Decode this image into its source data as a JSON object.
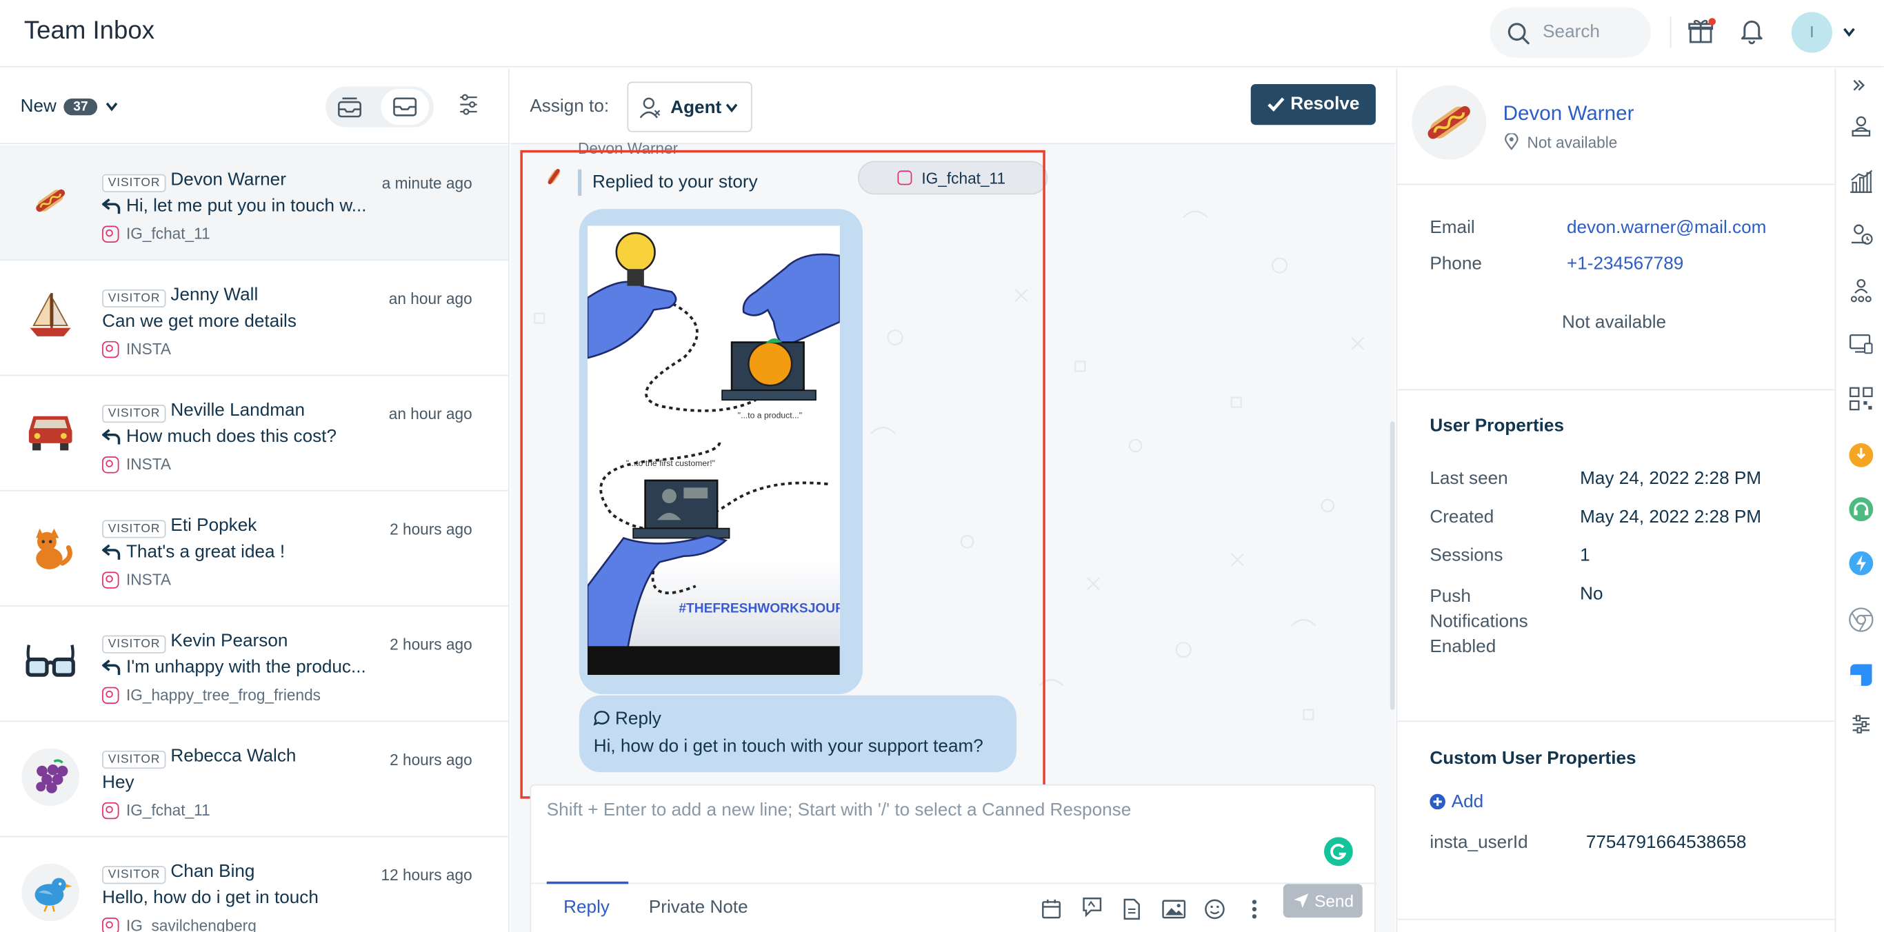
{
  "header": {
    "title": "Team Inbox",
    "search_placeholder": "Search",
    "avatar_initial": "I"
  },
  "list": {
    "filter_label": "New",
    "filter_count": "37",
    "conversations": [
      {
        "badge": "VISITOR",
        "name": "Devon Warner",
        "time": "a minute ago",
        "message": "Hi, let me put you in touch w...",
        "channel": "IG_fchat_11",
        "reply_icon": true,
        "avatar": "hotdog-avatar"
      },
      {
        "badge": "VISITOR",
        "name": "Jenny Wall",
        "time": "an hour ago",
        "message": "Can we get more details",
        "channel": "INSTA",
        "reply_icon": false,
        "avatar": "sailboat-avatar"
      },
      {
        "badge": "VISITOR",
        "name": "Neville Landman",
        "time": "an hour ago",
        "message": "How much does this cost?",
        "channel": "INSTA",
        "reply_icon": true,
        "avatar": "car-avatar"
      },
      {
        "badge": "VISITOR",
        "name": "Eti Popkek",
        "time": "2 hours ago",
        "message": "That's a great idea !",
        "channel": "INSTA",
        "reply_icon": true,
        "avatar": "cat-avatar"
      },
      {
        "badge": "VISITOR",
        "name": "Kevin Pearson",
        "time": "2 hours ago",
        "message": "I'm unhappy with the produc...",
        "channel": "IG_happy_tree_frog_friends",
        "reply_icon": true,
        "avatar": "glasses-avatar"
      },
      {
        "badge": "VISITOR",
        "name": "Rebecca Walch",
        "time": "2 hours ago",
        "message": "Hey",
        "channel": "IG_fchat_11",
        "reply_icon": false,
        "avatar": "grapes-avatar"
      },
      {
        "badge": "VISITOR",
        "name": "Chan Bing",
        "time": "12 hours ago",
        "message": "Hello, how do i get in touch",
        "channel": "IG_savilchengberg",
        "reply_icon": false,
        "avatar": "bird-avatar"
      }
    ]
  },
  "chat": {
    "assign_label": "Assign to:",
    "agent_label": "Agent",
    "resolve_label": "Resolve",
    "sender_name": "Devon Warner",
    "story_reply_text": "Replied to your story",
    "channel_chip": "IG_fchat_11",
    "story": {
      "caption_product": "\"...to a product...\"",
      "caption_customer": "\"...to the first customer!\"",
      "hashtag": "#THEFRESHWORKSJOURNEY"
    },
    "reply_title": "Reply",
    "reply_message": "Hi, how do i get in touch with your support team?",
    "composer_placeholder": "Shift + Enter to add a new line; Start with '/' to select a Canned Response",
    "tab_reply": "Reply",
    "tab_private": "Private Note",
    "send_label": "Send"
  },
  "contact": {
    "name": "Devon Warner",
    "location": "Not available",
    "email_label": "Email",
    "email": "devon.warner@mail.com",
    "phone_label": "Phone",
    "phone": "+1-234567789",
    "extra": "Not available",
    "user_properties_title": "User Properties",
    "properties": [
      {
        "label": "Last seen",
        "value": "May 24, 2022 2:28 PM"
      },
      {
        "label": "Created",
        "value": "May 24, 2022 2:28 PM"
      },
      {
        "label": "Sessions",
        "value": "1"
      },
      {
        "label": "Push Notifications Enabled",
        "value": "No"
      }
    ],
    "custom_title": "Custom User Properties",
    "add_label": "Add",
    "custom": [
      {
        "label": "insta_userId",
        "value": "7754791664538658"
      }
    ]
  },
  "colors": {
    "accent": "#2c5cc5",
    "resolve_bg": "#264966",
    "highlight": "#e8402f",
    "bubble": "#c4dcf1",
    "instagram": "#e1306c"
  }
}
